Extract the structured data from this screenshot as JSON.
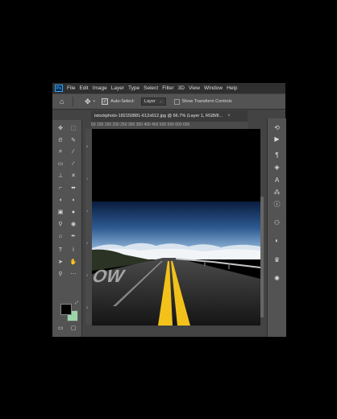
{
  "menu": {
    "items": [
      "File",
      "Edit",
      "Image",
      "Layer",
      "Type",
      "Select",
      "Filter",
      "3D",
      "View",
      "Window",
      "Help"
    ]
  },
  "app_logo": "Ps",
  "options_bar": {
    "auto_select_label": "Auto-Select:",
    "auto_select_checked": true,
    "target_select": "Layer",
    "transform_label": "Show Transform Controls",
    "transform_checked": false
  },
  "document": {
    "tab_title": "istockphoto-182150881-612x612.jpg @ 66.7% (Layer 1, RGB/8...",
    "close_symbol": "×",
    "ruler_numbers": "50   100   150   200   250   300   350   400   450   500   550   600   650"
  },
  "icons": {
    "home": "home-icon",
    "move": "move-tool-icon",
    "chevron": "chevron-down-icon"
  },
  "colors": {
    "foreground": "#000000",
    "background": "#9cd4aa",
    "ps_accent": "#31a8ff"
  }
}
